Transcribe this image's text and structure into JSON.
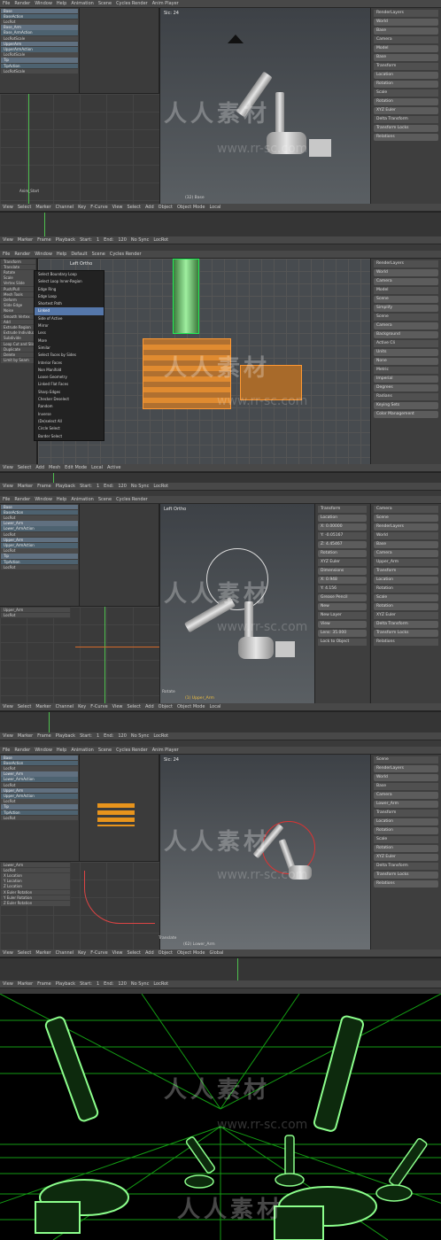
{
  "panel1": {
    "top_bar": [
      "File",
      "Render",
      "Window",
      "Help",
      "Animation",
      "Scene",
      "Cycles Render",
      "Anim Player"
    ],
    "channels": [
      {
        "label": "Base",
        "kind": "obj"
      },
      {
        "label": "BaseAction",
        "kind": "act"
      },
      {
        "label": "LocRot",
        "kind": "sub"
      },
      {
        "label": "Base_Arm",
        "kind": "obj"
      },
      {
        "label": "Base_ArmAction",
        "kind": "act"
      },
      {
        "label": "LocRotScale",
        "kind": "sub"
      },
      {
        "label": "UpperArm",
        "kind": "obj"
      },
      {
        "label": "UpperArmAction",
        "kind": "act"
      },
      {
        "label": "LocRotScale",
        "kind": "sub"
      },
      {
        "label": "Tip",
        "kind": "obj"
      },
      {
        "label": "TipAction",
        "kind": "act"
      },
      {
        "label": "LocRotScale",
        "kind": "sub"
      }
    ],
    "dope_ticks": [
      "50",
      "100",
      "150",
      "200"
    ],
    "viewport_label": "Sic: 24",
    "viewport_bottom": "(32) Base",
    "anim_start": "Anim_Start",
    "graph_ticks": [
      "0",
      "50",
      "100",
      "150",
      "200"
    ],
    "menus": [
      "View",
      "Select",
      "Marker",
      "Channel",
      "Key",
      "F-Curve",
      "View",
      "Select",
      "Add",
      "Object",
      "Object Mode",
      "Local"
    ],
    "timeline_menus": [
      "View",
      "Marker",
      "Frame",
      "Playback",
      "Start:",
      "1",
      "End:",
      "120",
      "No Sync",
      "LocRot"
    ],
    "props": [
      "RenderLayers",
      "World",
      "Base",
      "Camera",
      "Model",
      "Base",
      "Transform",
      "Location",
      "Rotation",
      "Scale",
      "Rotation",
      "XYZ Euler",
      "Delta Transform",
      "Transform Locks",
      "Relations"
    ]
  },
  "panel2": {
    "top_bar": [
      "File",
      "Render",
      "Window",
      "Help",
      "Default",
      "Scene",
      "Cycles Render"
    ],
    "left_tools": [
      "Transform",
      "Translate",
      "Rotate",
      "Scale",
      "Vertex Slide",
      "Push/Pull",
      "Mesh Tools",
      "Deform",
      "Slide Edge",
      "Noise",
      "Smooth Vertex",
      "Add",
      "Extrude Region",
      "Extrude Individual",
      "Subdivide",
      "Loop Cut and Slide",
      "Duplicate",
      "Delete",
      "Limit by Seam"
    ],
    "viewport_label": "Left Ortho",
    "select_menu": [
      {
        "label": "Select Boundary Loop",
        "hl": false
      },
      {
        "label": "Select Loop Inner-Region",
        "hl": false
      },
      {
        "label": "Edge Ring",
        "hl": false
      },
      {
        "label": "Edge Loop",
        "hl": false
      },
      {
        "label": "Shortest Path",
        "hl": false
      },
      {
        "label": "Linked",
        "hl": true
      },
      {
        "label": "Side of Active",
        "hl": false
      },
      {
        "label": "Mirror",
        "hl": false
      },
      {
        "label": "Less",
        "hl": false
      },
      {
        "label": "More",
        "hl": false
      },
      {
        "label": "Similar",
        "hl": false
      },
      {
        "label": "Select Faces by Sides",
        "hl": false
      },
      {
        "label": "Interior Faces",
        "hl": false
      },
      {
        "label": "Non Manifold",
        "hl": false
      },
      {
        "label": "Loose Geometry",
        "hl": false
      },
      {
        "label": "Linked Flat Faces",
        "hl": false
      },
      {
        "label": "Sharp Edges",
        "hl": false
      },
      {
        "label": "Checker Deselect",
        "hl": false
      },
      {
        "label": "Random",
        "hl": false
      },
      {
        "label": "Inverse",
        "hl": false
      },
      {
        "label": "(De)select All",
        "hl": false
      },
      {
        "label": "Circle Select",
        "hl": false
      },
      {
        "label": "Border Select",
        "hl": false
      }
    ],
    "menus": [
      "View",
      "Select",
      "Add",
      "Mesh",
      "Edit Mode",
      "Local",
      "Active"
    ],
    "timeline_menus": [
      "View",
      "Marker",
      "Frame",
      "Playback",
      "Start:",
      "1",
      "End:",
      "120",
      "No Sync",
      "LocRot"
    ],
    "props": [
      "RenderLayers",
      "World",
      "Camera",
      "Model",
      "Scene",
      "Simplify",
      "Scene",
      "Camera",
      "Background",
      "Active Cli",
      "Units",
      "None",
      "Metric",
      "Imperial",
      "Degrees",
      "Radians",
      "Keying Sets",
      "Color Management"
    ]
  },
  "panel3": {
    "top_bar": [
      "File",
      "Render",
      "Window",
      "Help",
      "Animation",
      "Scene",
      "Cycles Render"
    ],
    "channels": [
      {
        "label": "Base",
        "kind": "obj"
      },
      {
        "label": "BaseAction",
        "kind": "act"
      },
      {
        "label": "LocRot",
        "kind": "sub"
      },
      {
        "label": "Lower_Arm",
        "kind": "obj"
      },
      {
        "label": "Lower_ArmAction",
        "kind": "act"
      },
      {
        "label": "LocRot",
        "kind": "sub"
      },
      {
        "label": "Upper_Arm",
        "kind": "obj"
      },
      {
        "label": "Upper_ArmAction",
        "kind": "act"
      },
      {
        "label": "LocRot",
        "kind": "sub"
      },
      {
        "label": "Tip",
        "kind": "obj"
      },
      {
        "label": "TipAction",
        "kind": "act"
      },
      {
        "label": "LocRot",
        "kind": "sub"
      }
    ],
    "graph_channels": [
      "Upper_Arm",
      "LocRot"
    ],
    "viewport_label": "Left Ortho",
    "viewport_bottom": "(1) Upper_Arm",
    "op_label": "Rotate",
    "transform_panel": [
      "Transform",
      "Location",
      "X: 0.00000",
      "Y: -0.05167",
      "Z: 4.45467",
      "Rotation",
      "XYZ Euler",
      "Dimensions",
      "X: 0.948",
      "Y: 4.156",
      "Grease Pencil",
      "New",
      "New Layer",
      "View",
      "Lens: 35.000",
      "Lock to Object"
    ],
    "menus": [
      "View",
      "Select",
      "Marker",
      "Channel",
      "Key",
      "F-Curve",
      "View",
      "Select",
      "Add",
      "Object",
      "Object Mode",
      "Local"
    ],
    "timeline_menus": [
      "View",
      "Marker",
      "Frame",
      "Playback",
      "Start:",
      "1",
      "End:",
      "120",
      "No Sync",
      "LocRot"
    ],
    "props": [
      "Camera",
      "Scene",
      "RenderLayers",
      "World",
      "Base",
      "Camera",
      "Upper_Arm",
      "Transform",
      "Location",
      "Rotation",
      "Scale",
      "Rotation",
      "XYZ Euler",
      "Delta Transform",
      "Transform Locks",
      "Relations"
    ]
  },
  "panel4": {
    "top_bar": [
      "File",
      "Render",
      "Window",
      "Help",
      "Animation",
      "Scene",
      "Cycles Render",
      "Anim Player"
    ],
    "channels": [
      {
        "label": "Base",
        "kind": "obj"
      },
      {
        "label": "BaseAction",
        "kind": "act"
      },
      {
        "label": "LocRot",
        "kind": "sub"
      },
      {
        "label": "Lower_Arm",
        "kind": "obj"
      },
      {
        "label": "Lower_ArmAction",
        "kind": "act"
      },
      {
        "label": "LocRot",
        "kind": "sub"
      },
      {
        "label": "Upper_Arm",
        "kind": "obj"
      },
      {
        "label": "Upper_ArmAction",
        "kind": "act"
      },
      {
        "label": "LocRot",
        "kind": "sub"
      },
      {
        "label": "Tip",
        "kind": "obj"
      },
      {
        "label": "TipAction",
        "kind": "act"
      },
      {
        "label": "LocRot",
        "kind": "sub"
      }
    ],
    "curve_channels": [
      "Lower_Arm",
      "LocRot",
      "X Location",
      "Y Location",
      "Z Location",
      "X Euler Rotation",
      "Y Euler Rotation",
      "Z Euler Rotation"
    ],
    "viewport_label": "Sic: 24",
    "viewport_bottom": "(62) Lower_Arm",
    "op_label": "Translate",
    "menus": [
      "View",
      "Select",
      "Marker",
      "Channel",
      "Key",
      "F-Curve",
      "View",
      "Select",
      "Add",
      "Object",
      "Object Mode",
      "Global"
    ],
    "timeline_menus": [
      "View",
      "Marker",
      "Frame",
      "Playback",
      "Start:",
      "1",
      "End:",
      "120",
      "No Sync",
      "LocRot"
    ],
    "props": [
      "Scene",
      "RenderLayers",
      "World",
      "Base",
      "Camera",
      "Lower_Arm",
      "Transform",
      "Location",
      "Rotation",
      "Scale",
      "Rotation",
      "XYZ Euler",
      "Delta Transform",
      "Transform Locks",
      "Relations"
    ]
  },
  "render": {},
  "watermark": {
    "text": "人人素材",
    "url": "www.rr-sc.com"
  }
}
